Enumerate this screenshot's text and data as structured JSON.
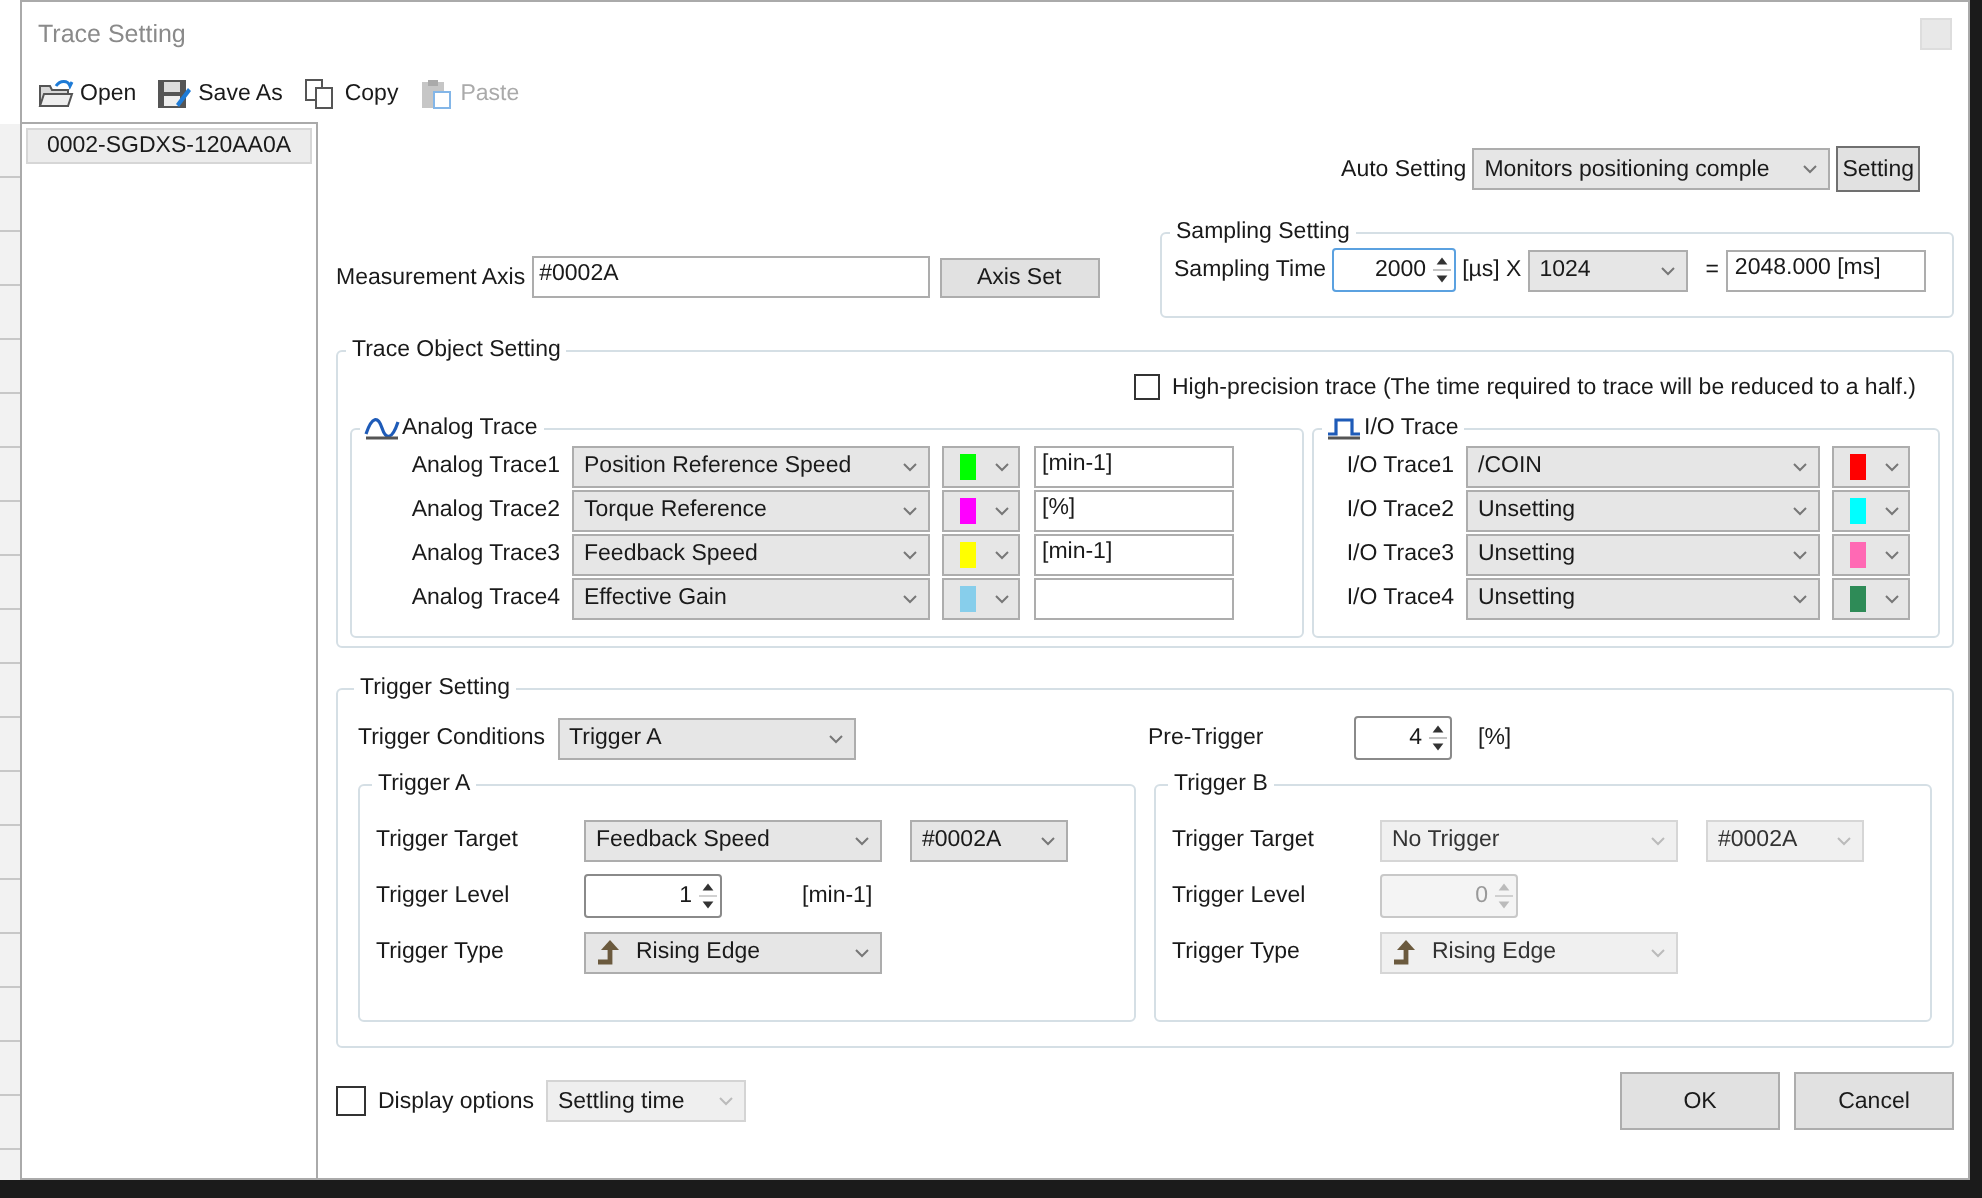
{
  "window": {
    "title": "Trace Setting"
  },
  "toolbar": [
    {
      "kind": "open",
      "label": "Open",
      "disabled": false
    },
    {
      "kind": "save",
      "label": "Save As",
      "disabled": false
    },
    {
      "kind": "copy",
      "label": "Copy",
      "disabled": false
    },
    {
      "kind": "paste",
      "label": "Paste",
      "disabled": true
    }
  ],
  "device_list": [
    {
      "label": "0002-SGDXS-120AA0A",
      "selected": true
    }
  ],
  "auto_setting": {
    "label": "Auto Setting",
    "value": "Monitors positioning comple",
    "button": "Setting"
  },
  "measurement_axis": {
    "label": "Measurement Axis",
    "value": "#0002A",
    "button": "Axis Set"
  },
  "sampling": {
    "title": "Sampling Setting",
    "label": "Sampling Time",
    "value": "2000",
    "unit": "[µs] X",
    "count": "1024",
    "equals": "=",
    "result": "2048.000 [ms]"
  },
  "trace_object": {
    "title": "Trace Object Setting",
    "high_precision": {
      "label": "High-precision trace (The time required to trace will be reduced to a half.)",
      "checked": false
    },
    "analog": {
      "title": "Analog Trace",
      "rows": [
        {
          "label": "Analog Trace1",
          "value": "Position Reference Speed",
          "color": "#00ff00",
          "unit": "[min-1]"
        },
        {
          "label": "Analog Trace2",
          "value": "Torque Reference",
          "color": "#ff00ff",
          "unit": "[%]"
        },
        {
          "label": "Analog Trace3",
          "value": "Feedback Speed",
          "color": "#ffff00",
          "unit": "[min-1]"
        },
        {
          "label": "Analog Trace4",
          "value": "Effective Gain",
          "color": "#87ceeb"
        }
      ]
    },
    "io": {
      "title": "I/O Trace",
      "rows": [
        {
          "label": "I/O Trace1",
          "value": "/COIN",
          "color": "#ff0000"
        },
        {
          "label": "I/O Trace2",
          "value": "Unsetting",
          "color": "#00ffff"
        },
        {
          "label": "I/O Trace3",
          "value": "Unsetting",
          "color": "#ff69b4"
        },
        {
          "label": "I/O Trace4",
          "value": "Unsetting",
          "color": "#2e8b57"
        }
      ]
    }
  },
  "trigger": {
    "title": "Trigger Setting",
    "conditions_label": "Trigger Conditions",
    "conditions_value": "Trigger A",
    "pre_trigger_label": "Pre-Trigger",
    "pre_trigger_value": "4",
    "pre_trigger_unit": "[%]",
    "groups": [
      {
        "title": "Trigger A",
        "disabled": false,
        "target_label": "Trigger Target",
        "target": "Feedback Speed",
        "axis": "#0002A",
        "level_label": "Trigger Level",
        "level_value": "1",
        "level_unit": "[min-1]",
        "type_label": "Trigger Type",
        "type": "Rising Edge"
      },
      {
        "title": "Trigger B",
        "disabled": true,
        "target_label": "Trigger Target",
        "target": "No Trigger",
        "axis": "#0002A",
        "level_label": "Trigger Level",
        "level_value": "0",
        "type_label": "Trigger Type",
        "type": "Rising Edge"
      }
    ]
  },
  "display_options": {
    "label": "Display options",
    "checked": false,
    "value": "Settling time",
    "disabled": true
  },
  "buttons": [
    "OK",
    "Cancel"
  ]
}
